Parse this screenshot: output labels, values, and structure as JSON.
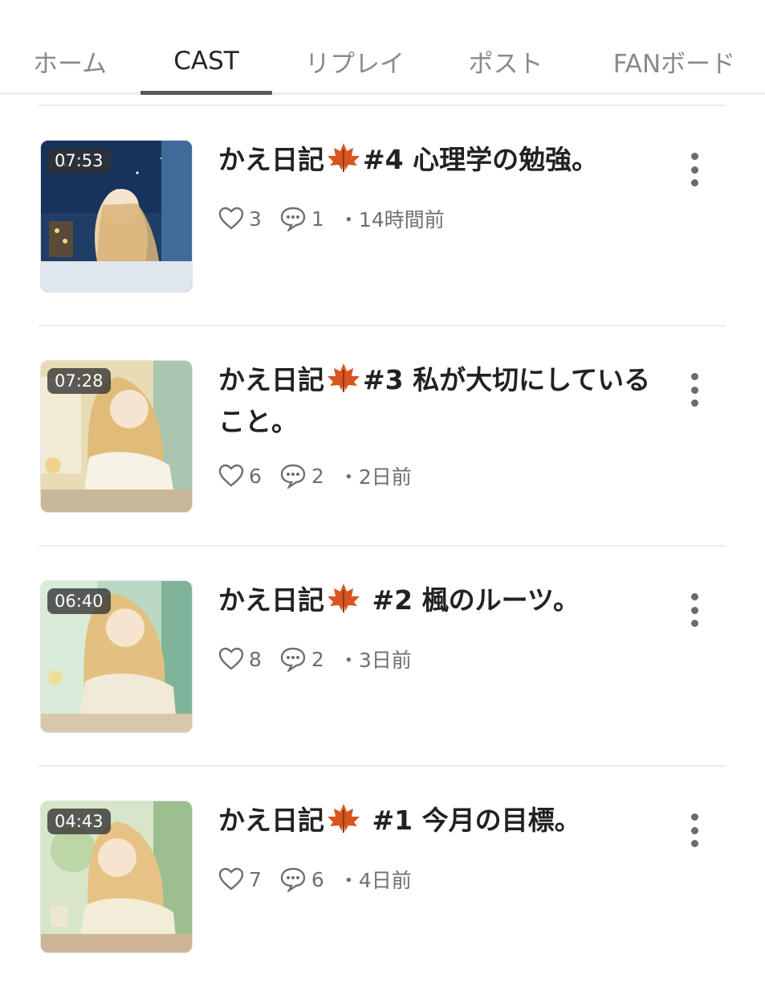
{
  "tabs": [
    {
      "label": "ホーム",
      "active": false
    },
    {
      "label": "CAST",
      "active": true
    },
    {
      "label": "リプレイ",
      "active": false
    },
    {
      "label": "ポスト",
      "active": false
    },
    {
      "label": "FANボード",
      "active": false
    }
  ],
  "casts": [
    {
      "duration": "07:53",
      "title_prefix": "かえ日記",
      "title_rest": "#4 心理学の勉強。",
      "likes": "3",
      "comments": "1",
      "time": "・14時間前",
      "thumb_colors": [
        "#1f3d66",
        "#3f6a9a",
        "#e9d2a8",
        "#d9b479"
      ]
    },
    {
      "duration": "07:28",
      "title_prefix": "かえ日記",
      "title_rest": "#3 私が大切にしていること。",
      "likes": "6",
      "comments": "2",
      "time": "・2日前",
      "thumb_colors": [
        "#e7dcb5",
        "#a9c7b0",
        "#f3e7cd",
        "#e0bb7a"
      ]
    },
    {
      "duration": "06:40",
      "title_prefix": "かえ日記",
      "title_rest": " #2 楓のルーツ。",
      "likes": "8",
      "comments": "2",
      "time": "・3日前",
      "thumb_colors": [
        "#b9d9c4",
        "#7fb49a",
        "#f2ead8",
        "#e3c07f"
      ]
    },
    {
      "duration": "04:43",
      "title_prefix": "かえ日記",
      "title_rest": " #1 今月の目標。",
      "likes": "7",
      "comments": "6",
      "time": "・4日前",
      "thumb_colors": [
        "#d7e5c9",
        "#9cbf8f",
        "#f3ecd8",
        "#e6c384"
      ]
    }
  ],
  "colors": {
    "accent_underline": "#5a5a5a",
    "text_primary": "#222222",
    "text_muted": "#6f6f6f",
    "leaf": "#d9541e"
  },
  "icons": {
    "like": "heart-icon",
    "comment": "speech-bubble-icon",
    "more": "kebab-menu-icon",
    "leaf": "maple-leaf-icon"
  }
}
